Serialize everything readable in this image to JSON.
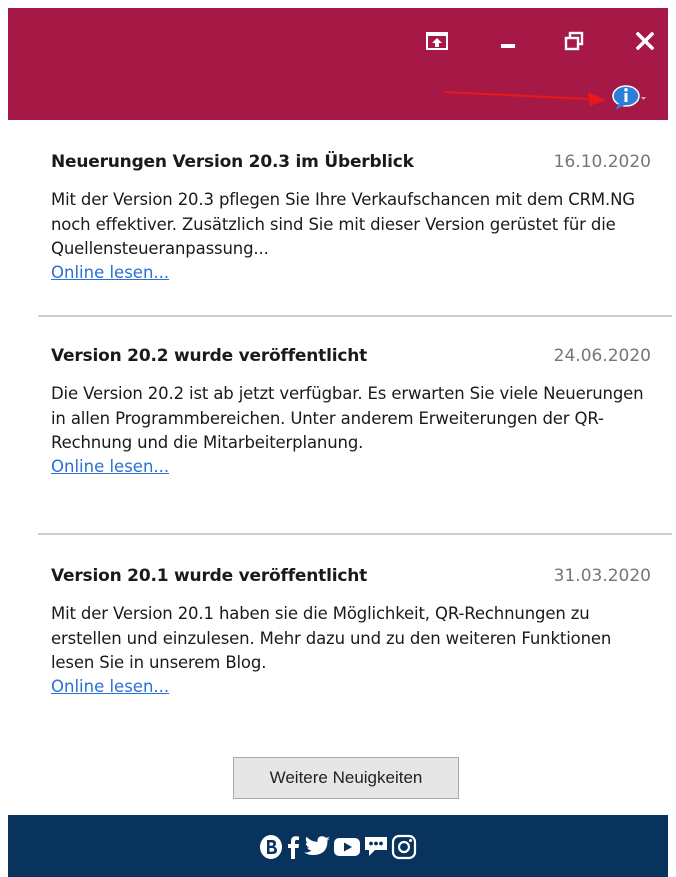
{
  "window": {
    "controls": [
      "pin-icon",
      "minimize-icon",
      "restore-icon",
      "close-icon"
    ],
    "info_icon": "info-speech-bubble-icon",
    "accent_color": "#a61846",
    "footer_color": "#07335c"
  },
  "news": [
    {
      "title": "Neuerungen Version 20.3 im Überblick",
      "date": "16.10.2020",
      "body": "Mit der Version 20.3 pflegen Sie Ihre Verkaufschancen mit dem CRM.NG noch effektiver. Zusätzlich sind Sie mit dieser Version gerüstet für die Quellensteueranpassung...",
      "link": "Online lesen..."
    },
    {
      "title": "Version 20.2 wurde veröffentlicht",
      "date": "24.06.2020",
      "body": "Die Version 20.2 ist ab jetzt verfügbar. Es erwarten Sie viele Neuerungen in allen Programmbereichen. Unter anderem Erweiterungen der QR-Rechnung und die Mitarbeiterplanung.",
      "link": "Online lesen..."
    },
    {
      "title": "Version 20.1 wurde veröffentlicht",
      "date": "31.03.2020",
      "body": "Mit der Version 20.1 haben sie die Möglichkeit, QR-Rechnungen zu erstellen und einzulesen. Mehr dazu und zu den weiteren Funktionen lesen Sie in unserem Blog.",
      "link": "Online lesen..."
    }
  ],
  "more_button": "Weitere Neuigkeiten",
  "social_icons": [
    "blog-icon",
    "facebook-icon",
    "twitter-icon",
    "youtube-icon",
    "chat-icon",
    "instagram-icon"
  ]
}
